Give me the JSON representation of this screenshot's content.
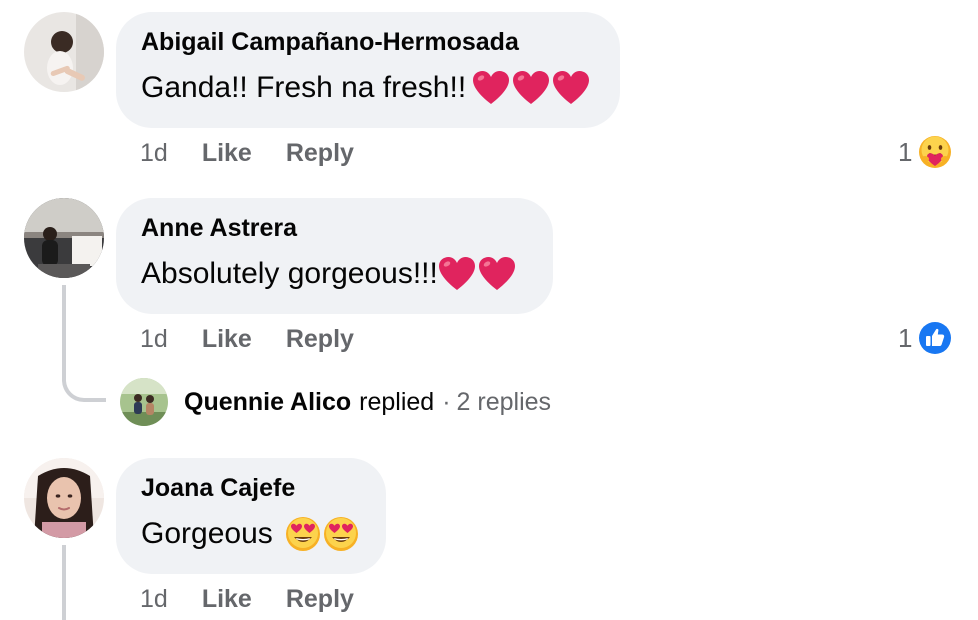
{
  "comments": [
    {
      "author": "Abigail Campañano-Hermosada",
      "text": "Ganda!! Fresh na fresh!!",
      "emojis": [
        "red-heart",
        "red-heart",
        "red-heart"
      ],
      "time": "1d",
      "like_label": "Like",
      "reply_label": "Reply",
      "reaction_count": "1",
      "reaction_icon": "care-reaction-icon"
    },
    {
      "author": "Anne Astrera",
      "text": "Absolutely gorgeous!!!",
      "emojis": [
        "red-heart",
        "red-heart"
      ],
      "time": "1d",
      "like_label": "Like",
      "reply_label": "Reply",
      "reaction_count": "1",
      "reaction_icon": "like-reaction-icon",
      "replies": {
        "name": "Quennie Alico",
        "verb": "replied",
        "separator": "·",
        "count_label": "2 replies"
      }
    },
    {
      "author": "Joana Cajefe",
      "text": "Gorgeous",
      "emojis": [
        "heart-eyes",
        "heart-eyes"
      ],
      "time": "1d",
      "like_label": "Like",
      "reply_label": "Reply"
    }
  ],
  "colors": {
    "bubble": "#f0f2f5",
    "secondary_text": "#65676b",
    "like_blue": "#1877f2",
    "heart_red": "#e0245e",
    "thread_line": "#ced0d4"
  }
}
